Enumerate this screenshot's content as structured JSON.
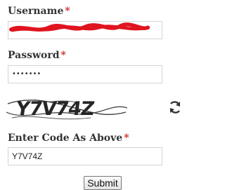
{
  "form": {
    "username": {
      "label": "Username",
      "required_mark": "*",
      "value_redacted": true,
      "redaction_color": "#e0141f"
    },
    "password": {
      "label": "Password",
      "required_mark": "*",
      "masked_value": "•••••••"
    },
    "captcha": {
      "image_text": "Y7V74Z",
      "refresh_icon": "refresh-icon"
    },
    "code": {
      "label": "Enter Code As Above",
      "required_mark": "*",
      "value": "Y7V74Z"
    },
    "submit_label": "Submit"
  },
  "colors": {
    "label_text": "#333333",
    "required_mark": "#cc2a2a",
    "field_border": "#d4d4d4"
  }
}
